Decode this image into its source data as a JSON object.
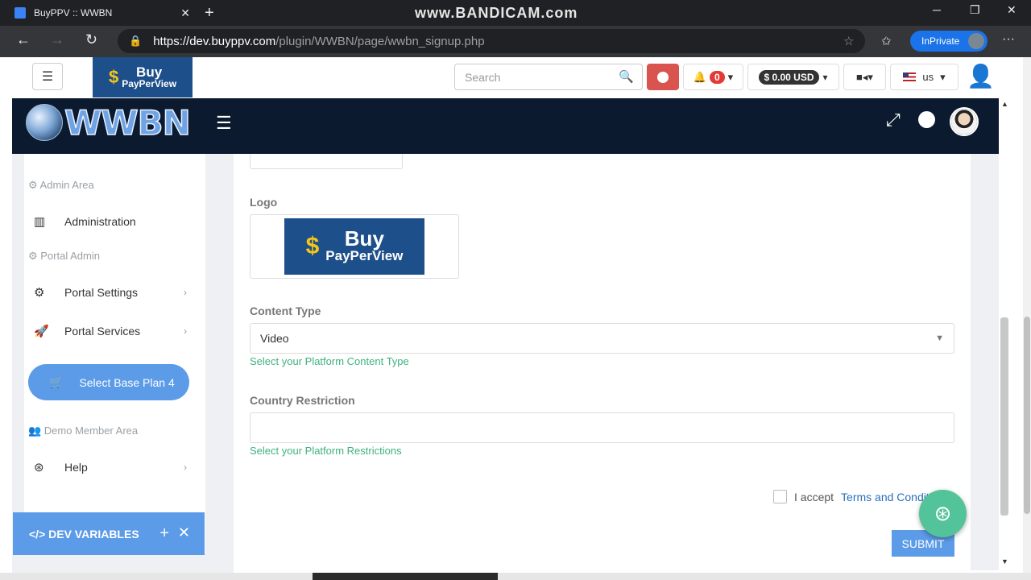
{
  "browser": {
    "tab_title": "BuyPPV :: WWBN",
    "tab_close": "✕",
    "new_tab": "+",
    "watermark": "www.BANDICAM.com",
    "url_domain": "https://dev.buyppv.com",
    "url_path": "/plugin/WWBN/page/wwbn_signup.php",
    "inprivate": "InPrivate",
    "win_min": "─",
    "win_max": "❐",
    "win_close": "✕",
    "back": "←",
    "forward": "→",
    "refresh": "↻",
    "lock": "🔒",
    "star": "☆",
    "favorites": "✩",
    "more": "···"
  },
  "header": {
    "logo_line1": "Buy",
    "logo_line2": "PayPerView",
    "logo_symbol": "$",
    "search_placeholder": "Search",
    "search_icon": "🔍",
    "notifications_count": "0",
    "balance": "$ 0.00 USD",
    "language": "us",
    "dropdown_caret": "▾",
    "menu_icon": "☰",
    "bell_icon": "🔔",
    "camera_icon": "■◂",
    "user_icon": "👤"
  },
  "appnav": {
    "brand": "WWBN",
    "menu_icon": "☰",
    "expand_icon": "⤢",
    "globe_icon": "●"
  },
  "sidebar": {
    "admin_area": "⚙ Admin Area",
    "administration": "Administration",
    "portal_admin": "⚙ Portal Admin",
    "portal_settings": "Portal Settings",
    "portal_services": "Portal Services",
    "select_plan": "Select Base Plan 4",
    "demo_member": "👥 Demo Member Area",
    "help": "Help",
    "chevron": "›",
    "icons": {
      "administration": "▥",
      "portal_settings": "⚙",
      "portal_services": "🚀",
      "cart": "🛒",
      "help": "⊛"
    },
    "dev_vars": "</> DEV VARIABLES",
    "dev_plus": "+",
    "dev_close": "✕"
  },
  "form": {
    "logo_label": "Logo",
    "logo_line1": "Buy",
    "logo_line2": "PayPerView",
    "logo_symbol": "$",
    "content_type_label": "Content Type",
    "content_type_value": "Video",
    "content_type_help": "Select your Platform Content Type",
    "caret": "▼",
    "country_label": "Country Restriction",
    "country_help": "Select your Platform Restrictions",
    "terms_prefix": "I accept",
    "terms_link": "Terms and Conditions",
    "submit": "SUBMIT",
    "support_icon": "⊛"
  }
}
